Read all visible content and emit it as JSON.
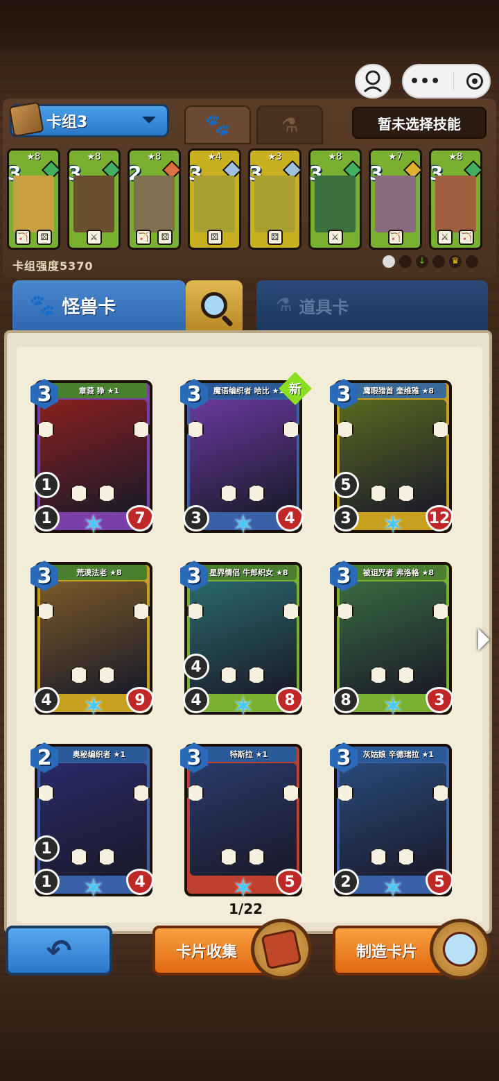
{
  "topbar": {
    "menu_dots": "•••"
  },
  "deck": {
    "name": "卡组3",
    "skill_label": "暂未选择技能",
    "strength_label": "卡组强度5370",
    "cards": [
      {
        "cost": "3",
        "stars": "★8",
        "frame": "#7ab030",
        "gem": "#40b060",
        "art": "#c8a040",
        "icons": [
          "🏹",
          "⚄"
        ]
      },
      {
        "cost": "3",
        "stars": "★8",
        "frame": "#7ab030",
        "gem": "#40b060",
        "art": "#6a5030",
        "icons": [
          "⚔"
        ]
      },
      {
        "cost": "2",
        "stars": "★8",
        "frame": "#7ab030",
        "gem": "#e07040",
        "art": "#807050",
        "icons": [
          "🏹",
          "⚄"
        ]
      },
      {
        "cost": "3",
        "stars": "★4",
        "frame": "#c8b020",
        "gem": "#a0c0e0",
        "art": "#a8a030",
        "icons": [
          "⚄"
        ]
      },
      {
        "cost": "3",
        "stars": "★3",
        "frame": "#c8b020",
        "gem": "#a0c0e0",
        "art": "#a8a030",
        "icons": [
          "⚄"
        ]
      },
      {
        "cost": "3",
        "stars": "★8",
        "frame": "#7ab030",
        "gem": "#40b060",
        "art": "#3a7040",
        "icons": [
          "⚔"
        ]
      },
      {
        "cost": "3",
        "stars": "★7",
        "frame": "#7ab030",
        "gem": "#e0b030",
        "art": "#8a6a80",
        "icons": [
          "🏹"
        ]
      },
      {
        "cost": "3",
        "stars": "★8",
        "frame": "#7ab030",
        "gem": "#40b060",
        "art": "#a06040",
        "icons": [
          "⚔",
          "🏹"
        ]
      }
    ]
  },
  "tabs": {
    "monster_label": "怪兽卡",
    "item_label": "道具卡"
  },
  "collection": {
    "page": "1/22",
    "cards": [
      {
        "name": "章莪 狰 ★1",
        "cost": "3",
        "atk": "1",
        "mid": "1",
        "hp": "7",
        "frame": "#7a40a8",
        "art": "#8a2020",
        "title_bg": "#4a8030",
        "new": false
      },
      {
        "name": "魔语编织者 哈比 ★1",
        "cost": "3",
        "atk": "3",
        "mid": "",
        "hp": "4",
        "frame": "#3a60a8",
        "art": "#6a3aa0",
        "title_bg": "#2a5a98",
        "new": true
      },
      {
        "name": "鹰眼猎首 奎维雅 ★8",
        "cost": "3",
        "atk": "3",
        "mid": "5",
        "hp": "12",
        "frame": "#c8a020",
        "art": "#5a6a20",
        "title_bg": "#3a6a9a",
        "new": false
      },
      {
        "name": "荒漠法老 ★8",
        "cost": "3",
        "atk": "4",
        "mid": "",
        "hp": "9",
        "frame": "#c8a020",
        "art": "#7a5a28",
        "title_bg": "#4a8030",
        "new": false
      },
      {
        "name": "星界情侣 牛郎织女 ★8",
        "cost": "3",
        "atk": "4",
        "mid": "4",
        "hp": "8",
        "frame": "#7ab030",
        "art": "#2a6a6a",
        "title_bg": "#4a8030",
        "new": false
      },
      {
        "name": "被诅咒者 弗洛格 ★8",
        "cost": "3",
        "atk": "8",
        "mid": "",
        "hp": "3",
        "frame": "#7ab030",
        "art": "#3a6a40",
        "title_bg": "#4a8030",
        "new": false
      },
      {
        "name": "奥秘编织者 ★1",
        "cost": "2",
        "atk": "1",
        "mid": "1",
        "hp": "4",
        "frame": "#3a60a8",
        "art": "#2a2a6a",
        "title_bg": "#2a5a98",
        "new": false
      },
      {
        "name": "特斯拉 ★1",
        "cost": "3",
        "atk": "",
        "mid": "",
        "hp": "5",
        "frame": "#c04030",
        "art": "#2a3a6a",
        "title_bg": "#2a5a98",
        "new": false
      },
      {
        "name": "灰姑娘 辛德瑞拉 ★1",
        "cost": "3",
        "atk": "2",
        "mid": "",
        "hp": "5",
        "frame": "#3a60a8",
        "art": "#2a4a7a",
        "title_bg": "#2a5a98",
        "new": false
      }
    ]
  },
  "bottom": {
    "collect_label": "卡片收集",
    "craft_label": "制造卡片"
  }
}
